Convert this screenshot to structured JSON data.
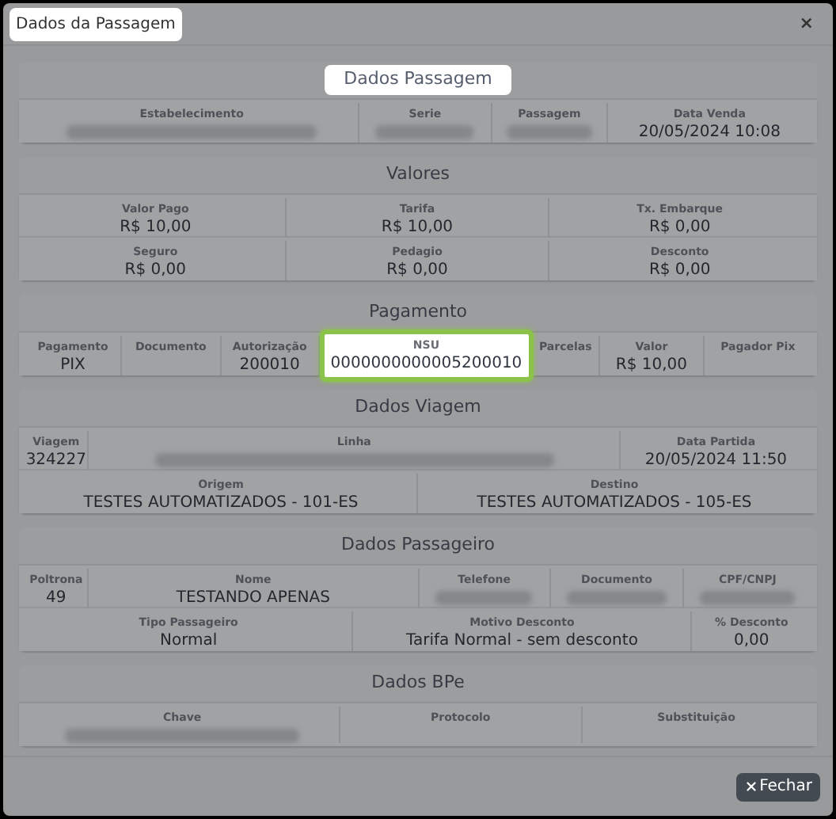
{
  "dialog": {
    "title": "Dados da Passagem",
    "title_highlighted": true,
    "close": "×"
  },
  "sections": [
    {
      "title": "Dados Passagem",
      "highlighted": true,
      "lines": [
        {
          "fields": [
            {
              "label": "Estabelecimento",
              "redacted": true
            },
            {
              "label": "Serie",
              "redacted": true
            },
            {
              "label": "Passagem",
              "redacted": true
            },
            {
              "label": "Data Venda",
              "value": "20/05/2024 10:08"
            }
          ]
        }
      ]
    },
    {
      "title": "Valores",
      "highlighted": false,
      "lines": [
        {
          "fields": [
            {
              "label": "Valor Pago",
              "value": "R$ 10,00"
            },
            {
              "label": "Tarifa",
              "value": "R$ 10,00"
            },
            {
              "label": "Tx. Embarque",
              "value": "R$ 0,00"
            }
          ]
        },
        {
          "fields": [
            {
              "label": "Seguro",
              "value": "R$ 0,00"
            },
            {
              "label": "Pedagio",
              "value": "R$ 0,00"
            },
            {
              "label": "Desconto",
              "value": "R$ 0,00"
            }
          ]
        }
      ]
    },
    {
      "title": "Pagamento",
      "highlighted": false,
      "lines": [
        {
          "fields": [
            {
              "label": "Pagamento",
              "value": "PIX"
            },
            {
              "label": "Documento"
            },
            {
              "label": "Autorização",
              "value": "200010"
            },
            {
              "label": "NSU",
              "value": "0000000000005200010",
              "highlighted": true
            },
            {
              "label": "Parcelas"
            },
            {
              "label": "Valor",
              "value": "R$ 10,00"
            },
            {
              "label": "Pagador Pix"
            }
          ]
        }
      ]
    },
    {
      "title": "Dados Viagem",
      "highlighted": false,
      "lines": [
        {
          "fields": [
            {
              "label": "Viagem",
              "value": "324227"
            },
            {
              "label": "Linha",
              "redacted": true
            },
            {
              "label": "Data Partida",
              "value": "20/05/2024 11:50"
            }
          ]
        },
        {
          "fields": [
            {
              "label": "Origem",
              "value": "TESTES AUTOMATIZADOS - 101-ES"
            },
            {
              "label": "Destino",
              "value": "TESTES AUTOMATIZADOS - 105-ES"
            }
          ]
        }
      ]
    },
    {
      "title": "Dados Passageiro",
      "highlighted": false,
      "lines": [
        {
          "fields": [
            {
              "label": "Poltrona",
              "value": "49"
            },
            {
              "label": "Nome",
              "value": "TESTANDO APENAS"
            },
            {
              "label": "Telefone",
              "redacted": true
            },
            {
              "label": "Documento",
              "redacted": true
            },
            {
              "label": "CPF/CNPJ",
              "redacted": true
            }
          ]
        },
        {
          "fields": [
            {
              "label": "Tipo Passageiro",
              "value": "Normal"
            },
            {
              "label": "Motivo Desconto",
              "value": "Tarifa Normal - sem desconto"
            },
            {
              "label": "% Desconto",
              "value": "0,00"
            }
          ]
        }
      ]
    },
    {
      "title": "Dados BPe",
      "highlighted": false,
      "lines": [
        {
          "fields": [
            {
              "label": "Chave",
              "redacted": true
            },
            {
              "label": "Protocolo"
            },
            {
              "label": "Substituição"
            }
          ]
        }
      ]
    }
  ],
  "footer": {
    "close_button": "Fechar"
  }
}
